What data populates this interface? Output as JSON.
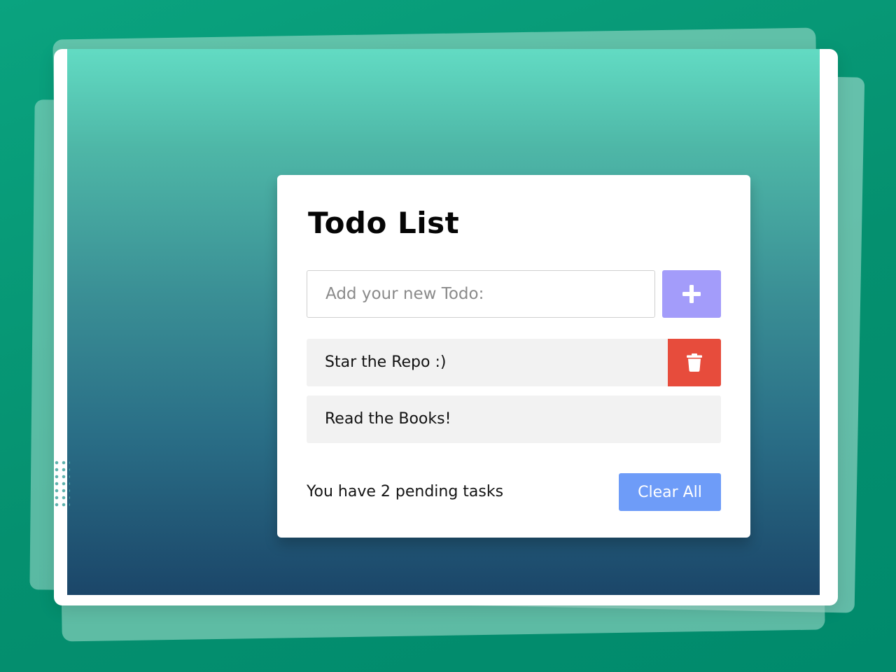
{
  "app": {
    "title": "Todo List"
  },
  "input": {
    "placeholder": "Add your new Todo:",
    "value": ""
  },
  "add_button": {
    "icon": "plus-icon"
  },
  "todos": [
    {
      "text": "Star the Repo :)",
      "delete_icon": "trash-icon"
    },
    {
      "text": "Read the Books!"
    }
  ],
  "footer": {
    "pending_text": "You have 2 pending tasks",
    "clear_label": "Clear All"
  },
  "colors": {
    "add_button": "#a39cfa",
    "delete_button": "#e74c3c",
    "clear_button": "#6e9cf8",
    "item_background": "#f2f2f2"
  }
}
